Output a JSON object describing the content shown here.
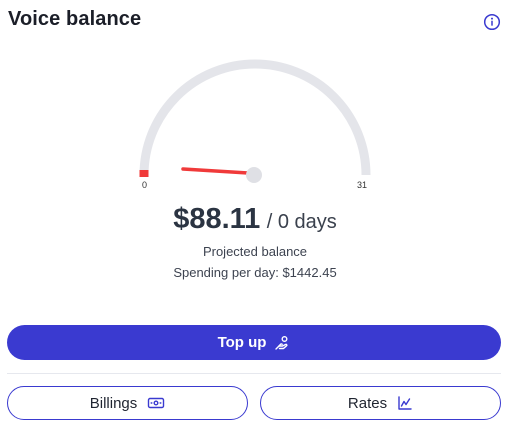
{
  "header": {
    "title": "Voice balance",
    "info_icon": "info-icon"
  },
  "gauge": {
    "min_label": "0",
    "max_label": "31",
    "value_days": 0,
    "max_days": 31,
    "track_color": "#e4e5ea",
    "needle_color": "#f03a3a"
  },
  "balance": {
    "amount": "$88.11",
    "days": "/ 0 days",
    "projected_label": "Projected balance",
    "spending": "Spending per day: $1442.45"
  },
  "actions": {
    "topup_label": "Top up",
    "topup_icon": "hand-coins-icon",
    "billings_label": "Billings",
    "billings_icon": "banknote-icon",
    "rates_label": "Rates",
    "rates_icon": "line-chart-icon"
  },
  "colors": {
    "primary": "#3a3ad0",
    "heading": "#1b1e28"
  }
}
